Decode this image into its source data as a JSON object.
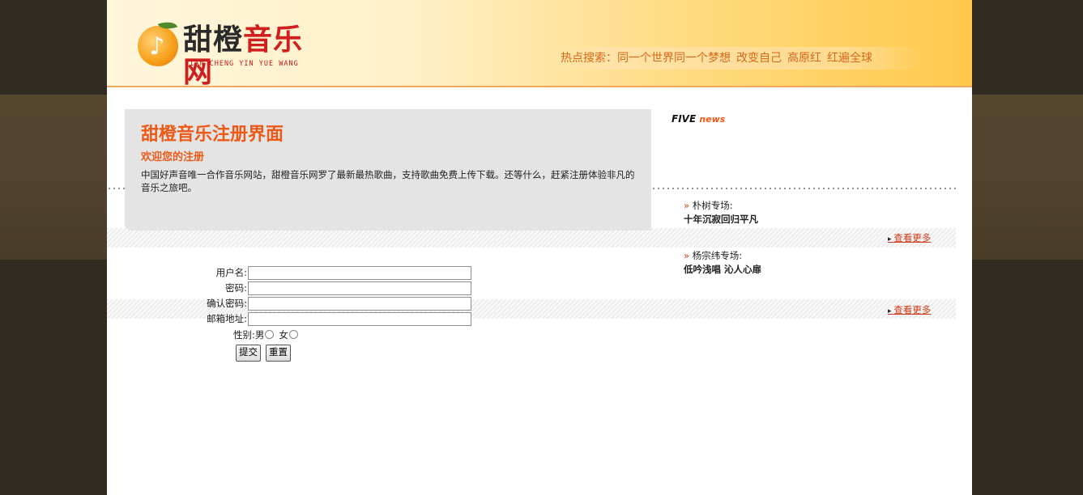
{
  "logo": {
    "icon": "music-orange-icon",
    "title_chars": [
      "甜橙",
      "音乐网"
    ],
    "subtitle": "TIAN CHENG YIN YUE WANG"
  },
  "hot_search": {
    "label": "热点搜索：",
    "terms": [
      "同一个世界同一个梦想",
      "改变自己",
      "高原红",
      "红遍全球"
    ]
  },
  "intro": {
    "title": "甜橙音乐注册界面",
    "subtitle": "欢迎您的注册",
    "text": "中国好声音唯一合作音乐网站，甜橙音乐网罗了最新最热歌曲，支持歌曲免费上传下载。还等什么，赶紧注册体验非凡的音乐之旅吧。"
  },
  "sidebar": {
    "heading_a": "FIVE",
    "heading_b": "news",
    "specials": [
      {
        "name": "朴树专场:",
        "title": "十年沉寂回归平凡"
      },
      {
        "name": "杨宗纬专场:",
        "title": "低吟浅唱 沁人心扉"
      }
    ],
    "more_label": "查看更多"
  },
  "form": {
    "username_label": "用户名:",
    "password_label": "密码:",
    "confirm_label": "确认密码:",
    "email_label": "邮箱地址:",
    "gender_label": "性别:",
    "gender_options": [
      "男",
      "女"
    ],
    "submit_label": "提交",
    "reset_label": "重置"
  },
  "colors": {
    "accent": "#ed5a17",
    "header_gradient_end": "#ffc94d",
    "page_background": "#312b22"
  }
}
